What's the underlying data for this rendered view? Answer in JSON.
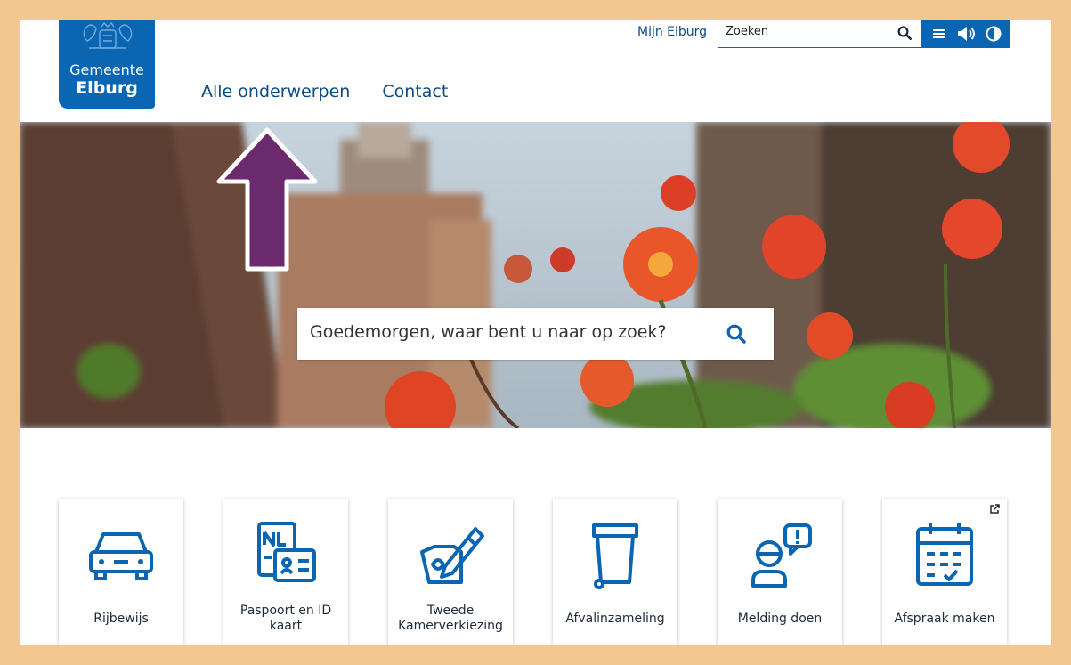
{
  "header": {
    "logo": {
      "line1": "Gemeente",
      "line2": "Elburg"
    },
    "nav": [
      {
        "label": "Alle onderwerpen"
      },
      {
        "label": "Contact"
      }
    ],
    "mijn_link": "Mijn Elburg",
    "search": {
      "placeholder": "Zoeken",
      "icon": "search-icon"
    },
    "tools": [
      "menu-icon",
      "speaker-icon",
      "contrast-icon"
    ]
  },
  "hero": {
    "search_placeholder": "Goedemorgen, waar bent u naar op zoek?",
    "search_icon": "search-icon"
  },
  "tiles": [
    {
      "label": "Rijbewijs",
      "icon": "car-icon"
    },
    {
      "label": "Paspoort en ID kaart",
      "icon": "passport-icon"
    },
    {
      "label": "Tweede Kamerverkiezing",
      "icon": "ballot-icon"
    },
    {
      "label": "Afvalinzameling",
      "icon": "waste-bin-icon"
    },
    {
      "label": "Melding doen",
      "icon": "report-icon"
    },
    {
      "label": "Afspraak maken",
      "icon": "calendar-icon",
      "external": true
    }
  ],
  "colors": {
    "brand": "#0a66b3",
    "link": "#0c4a86",
    "frame": "#f3c890",
    "arrow": "#6b2a6e"
  }
}
